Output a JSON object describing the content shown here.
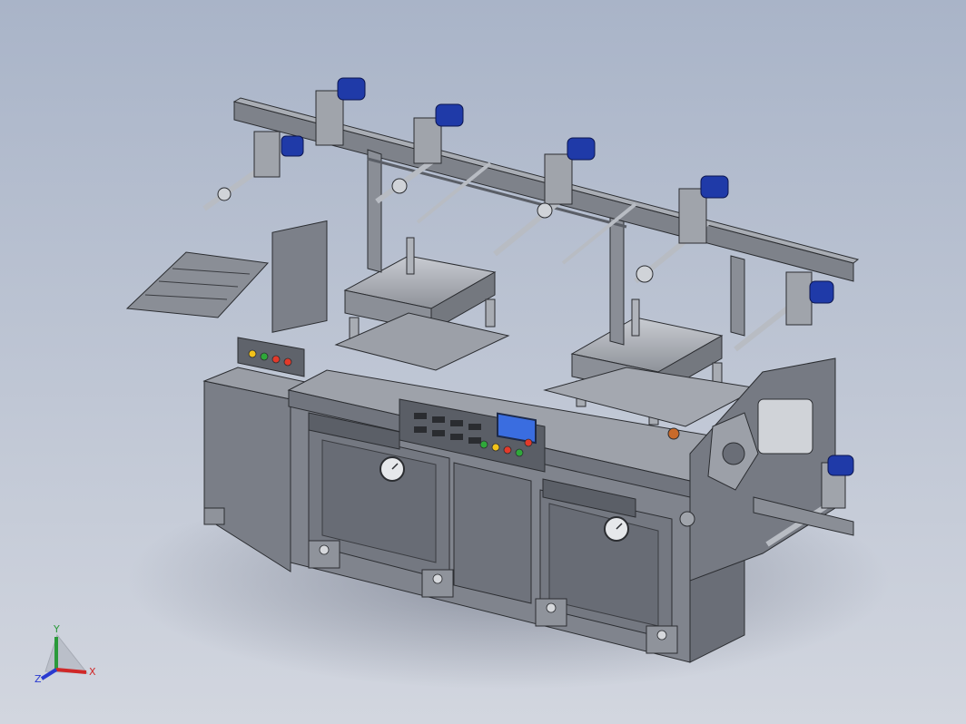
{
  "viewport": {
    "background_top": "#a9b4c8",
    "background_bottom": "#d2d6df"
  },
  "model": {
    "frame_color": "#6f737c",
    "panel_color": "#8a8e96",
    "motor_color": "#1f3aa8",
    "screen_color": "#3a6de0",
    "button_colors": [
      "#e23a2a",
      "#2fa83a",
      "#f2c21a",
      "#e23a2a"
    ]
  },
  "triad": {
    "x_label": "X",
    "y_label": "Y",
    "z_label": "Z",
    "x_color": "#d02828",
    "y_color": "#2a9a3a",
    "z_color": "#2a3ad0"
  }
}
